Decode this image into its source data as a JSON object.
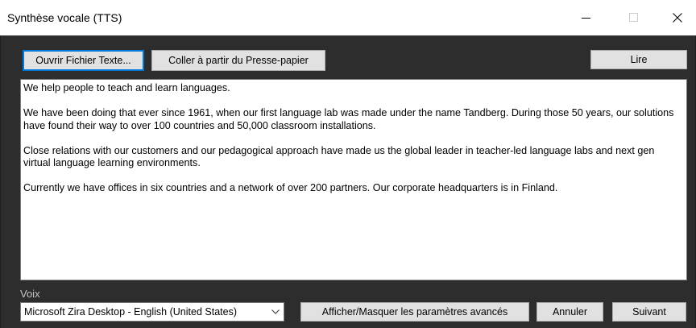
{
  "window": {
    "title": "Synthèse vocale (TTS)"
  },
  "toolbar": {
    "open_file_label": "Ouvrir Fichier Texte...",
    "paste_label": "Coller à partir du Presse-papier",
    "read_label": "Lire"
  },
  "text": {
    "paragraphs": [
      "We help people to teach and learn languages.",
      "We have been doing that ever since 1961, when our first language lab was made under the name Tandberg. During those 50 years, our solutions have found their way to over 100 countries and 50,000 classroom installations.",
      "Close relations with our customers and our pedagogical approach have made us the global leader in teacher-led language labs and next gen virtual language learning environments.",
      "Currently we have offices in six countries and a network of over 200 partners. Our corporate headquarters is in Finland."
    ]
  },
  "voice": {
    "label": "Voix",
    "selected": "Microsoft Zira Desktop - English (United States)"
  },
  "footer": {
    "advanced_label": "Afficher/Masquer les paramètres avancés",
    "cancel_label": "Annuler",
    "next_label": "Suivant"
  },
  "colors": {
    "client_background": "#2d2d2d",
    "focus_border": "#0078d7",
    "button_face": "#e1e1e1"
  }
}
